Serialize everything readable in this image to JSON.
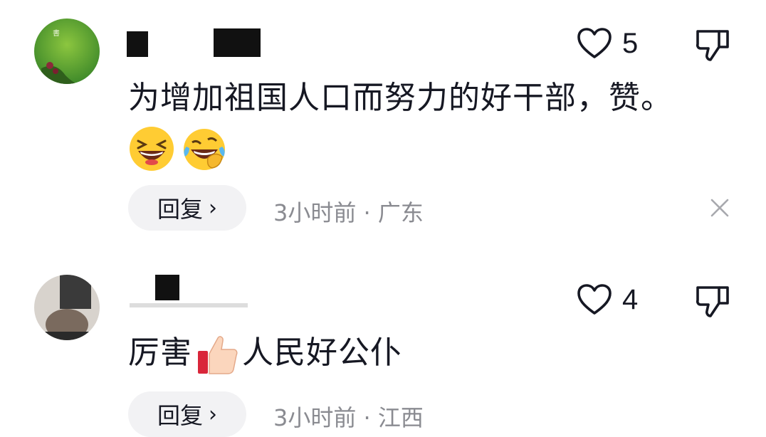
{
  "comments": [
    {
      "like_count": "5",
      "text": "为增加祖国人口而努力的好干部，赞。",
      "emojis": [
        "grinning-squint-emoji",
        "rolling-laughing-emoji"
      ],
      "reply_label": "回复",
      "reply_chevron": "›",
      "meta": "3小时前 · 广东",
      "icons": [
        "heart-outline-icon",
        "thumbs-down-icon",
        "close-icon"
      ]
    },
    {
      "like_count": "4",
      "text_before": "厉害",
      "text_after": "人民好公仆",
      "inline_emoji": "thumbs-up-emoji",
      "reply_label": "回复",
      "reply_chevron": "›",
      "meta": "3小时前 · 江西",
      "icons": [
        "heart-outline-icon",
        "thumbs-down-icon"
      ]
    }
  ],
  "colors": {
    "text": "#161823",
    "secondary": "#8a8b91",
    "reply_bg": "#f2f2f4"
  }
}
